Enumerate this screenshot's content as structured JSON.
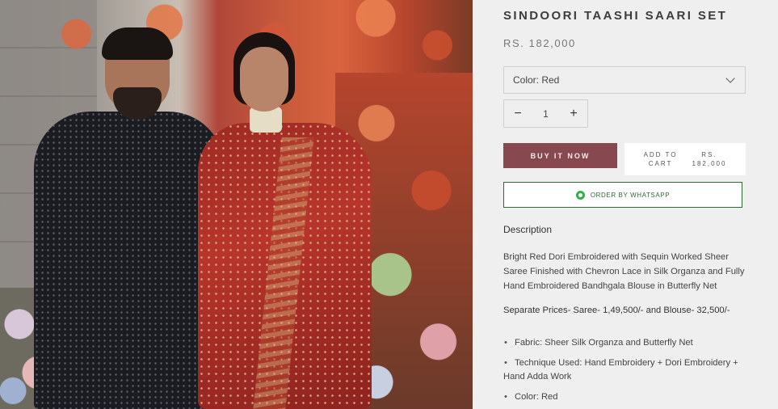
{
  "product": {
    "title": "SINDOORI TAASHI SAARI SET",
    "price": "RS. 182,000",
    "image_alt": "Couple in red embroidered saree and black sherwani in front of floral wall"
  },
  "variant_select": {
    "label": "Color: Red",
    "icon": "chevron-down-icon"
  },
  "quantity": {
    "minus": "−",
    "value": "1",
    "plus": "+"
  },
  "buttons": {
    "buy_now": "BUY IT NOW",
    "add_to_cart_line1": "ADD TO",
    "add_to_cart_line2": "CART",
    "cart_price_line1": "RS.",
    "cart_price_line2": "182,000",
    "whatsapp": "ORDER BY WHATSAPP"
  },
  "description": {
    "heading": "Description",
    "body": "Bright Red Dori Embroidered with Sequin Worked Sheer Saree Finished with Chevron Lace in Silk Organza and Fully Hand Embroidered Bandhgala Blouse in Butterfly Net",
    "separate_prices": "Separate Prices- Saree- 1,49,500/- and Blouse- 32,500/-",
    "bullets": [
      "Fabric: Sheer Silk Organza and Butterfly Net",
      "Technique Used: Hand Embroidery + Dori Embroidery + Hand Adda Work",
      "Color: Red"
    ]
  },
  "colors": {
    "buy_button": "#874850",
    "whatsapp_green": "#2e6b32",
    "panel_bg": "#efefef"
  }
}
